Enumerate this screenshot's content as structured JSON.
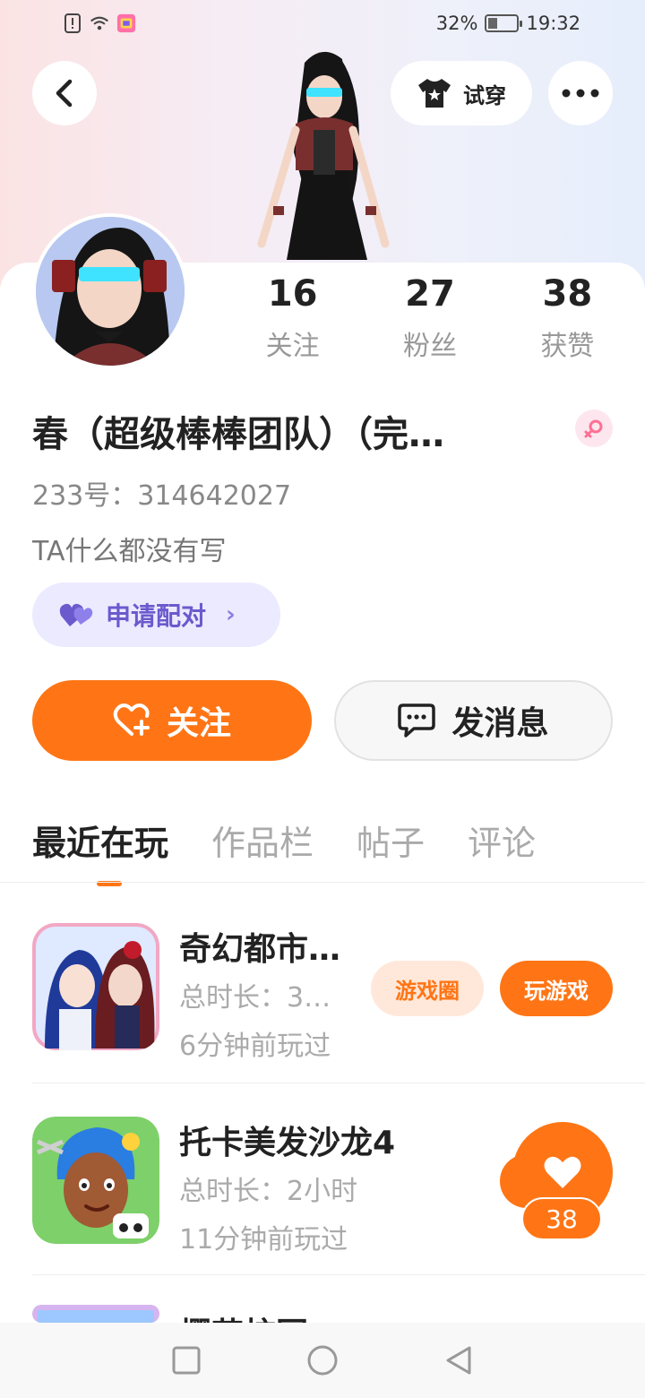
{
  "status_bar": {
    "battery_text": "32%",
    "battery_level": 0.32,
    "time": "19:32"
  },
  "header": {
    "tryon_label": "试穿"
  },
  "profile": {
    "stats": [
      {
        "num": "16",
        "label": "关注"
      },
      {
        "num": "27",
        "label": "粉丝"
      },
      {
        "num": "38",
        "label": "获赞"
      }
    ],
    "username": "春（超级棒棒团队）（完…",
    "uid": "233号：314642027",
    "bio": "TA什么都没有写",
    "pair_label": "申请配对",
    "pair_arrow": "›"
  },
  "actions": {
    "follow_label": "关注",
    "message_label": "发消息"
  },
  "tabs": [
    "最近在玩",
    "作品栏",
    "帖子",
    "评论"
  ],
  "games": [
    {
      "title": "奇幻都市…",
      "duration": "总时长：3…",
      "last_played": "6分钟前玩过",
      "circle_label": "游戏圈",
      "play_label": "玩游戏"
    },
    {
      "title": "托卡美发沙龙4",
      "duration": "总时长：2小时",
      "last_played": "11分钟前玩过"
    },
    {
      "title": "樱花校园"
    }
  ],
  "like_float": {
    "count": "38"
  },
  "colors": {
    "accent": "#ff7515",
    "pair_purple": "#6a5acd"
  }
}
